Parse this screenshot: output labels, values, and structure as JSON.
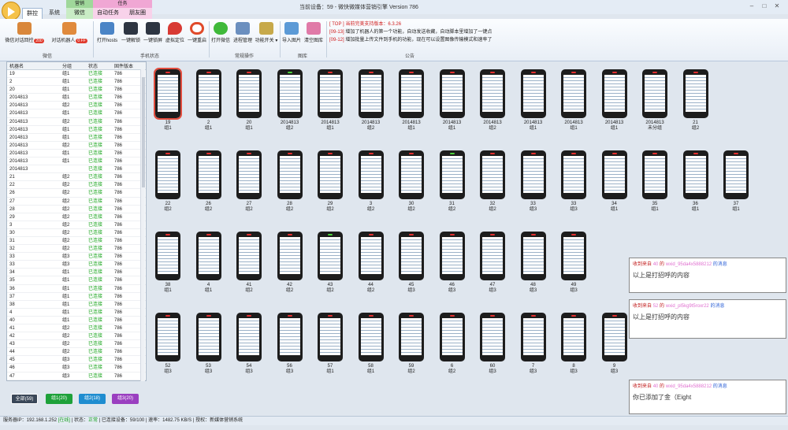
{
  "window": {
    "title": "当前设备：59 - 微快微媒体营销引擎 Version 786",
    "minimize": "–",
    "maximize": "□",
    "close": "✕"
  },
  "ribbon_tabs": {
    "ctx_green": "营销",
    "ctx_pink": "任务",
    "tabs": [
      "群控",
      "系统",
      "微信",
      "自动任务",
      "朋友圈"
    ]
  },
  "ribbon": {
    "buttons": {
      "wechat_dialog": "微信对话回控",
      "wechat_dialog_badge": "200",
      "robot_dialog": "对话机器人",
      "robot_dialog_badge": "0 FF",
      "open_hosts": "打开hosts",
      "unlock": "一键解锁",
      "lock": "一键锁屏",
      "virtual_location": "虚拟定位",
      "restart": "一键重启",
      "open_wechat": "打开微信",
      "process_mgmt": "进程管理",
      "func_switch": "功能开关",
      "import_images": "导入图片",
      "clear_gallery": "清空图库"
    },
    "groups": [
      "微信",
      "手机状态",
      "常规操作",
      "图库",
      "公告"
    ],
    "notice": {
      "line1_tag": "[ TOP ]",
      "line1": "当前完美支持版本：6.3.26",
      "line2_tag": "[09-13]",
      "line2": "增加了机器人的第一个功能，自动发送收藏，自动脚本里增加了一键点",
      "line3_tag": "[09-12]",
      "line3": "增加批量上传文件到手机的功能，现在可以设置图像传输模式和速率了"
    }
  },
  "table": {
    "headers": [
      "机器名",
      "分组",
      "状态",
      "固件版本"
    ],
    "rows": [
      [
        "19",
        "组1",
        "已连接",
        "786"
      ],
      [
        "2",
        "组1",
        "已连接",
        "786"
      ],
      [
        "20",
        "组1",
        "已连接",
        "786"
      ],
      [
        "2014813",
        "组1",
        "已连接",
        "786"
      ],
      [
        "2014813",
        "组2",
        "已连接",
        "786"
      ],
      [
        "2014813",
        "组1",
        "已连接",
        "786"
      ],
      [
        "2014813",
        "组2",
        "已连接",
        "786"
      ],
      [
        "2014813",
        "组1",
        "已连接",
        "786"
      ],
      [
        "2014813",
        "组1",
        "已连接",
        "786"
      ],
      [
        "2014813",
        "组2",
        "已连接",
        "786"
      ],
      [
        "2014813",
        "组1",
        "已连接",
        "786"
      ],
      [
        "2014813",
        "组1",
        "已连接",
        "786"
      ],
      [
        "2014813",
        "",
        "已连接",
        "786"
      ],
      [
        "21",
        "组2",
        "已连接",
        "786"
      ],
      [
        "22",
        "组2",
        "已连接",
        "786"
      ],
      [
        "26",
        "组2",
        "已连接",
        "786"
      ],
      [
        "27",
        "组2",
        "已连接",
        "786"
      ],
      [
        "28",
        "组2",
        "已连接",
        "786"
      ],
      [
        "29",
        "组2",
        "已连接",
        "786"
      ],
      [
        "3",
        "组2",
        "已连接",
        "786"
      ],
      [
        "30",
        "组2",
        "已连接",
        "786"
      ],
      [
        "31",
        "组2",
        "已连接",
        "786"
      ],
      [
        "32",
        "组2",
        "已连接",
        "786"
      ],
      [
        "33",
        "组3",
        "已连接",
        "786"
      ],
      [
        "33",
        "组3",
        "已连接",
        "786"
      ],
      [
        "34",
        "组1",
        "已连接",
        "786"
      ],
      [
        "35",
        "组1",
        "已连接",
        "786"
      ],
      [
        "36",
        "组1",
        "已连接",
        "786"
      ],
      [
        "37",
        "组1",
        "已连接",
        "786"
      ],
      [
        "38",
        "组1",
        "已连接",
        "786"
      ],
      [
        "4",
        "组1",
        "已连接",
        "786"
      ],
      [
        "40",
        "组1",
        "已连接",
        "786"
      ],
      [
        "41",
        "组2",
        "已连接",
        "786"
      ],
      [
        "42",
        "组2",
        "已连接",
        "786"
      ],
      [
        "43",
        "组2",
        "已连接",
        "786"
      ],
      [
        "44",
        "组2",
        "已连接",
        "786"
      ],
      [
        "45",
        "组3",
        "已连接",
        "786"
      ],
      [
        "46",
        "组3",
        "已连接",
        "786"
      ],
      [
        "47",
        "组3",
        "已连接",
        "786"
      ]
    ]
  },
  "filters": [
    "全部(59)",
    "组1(20)",
    "组2(18)",
    "组3(20)"
  ],
  "devices": [
    [
      "19",
      "组1",
      "r"
    ],
    [
      "2",
      "组1",
      "r"
    ],
    [
      "20",
      "组1",
      "r"
    ],
    [
      "2014813",
      "组2",
      "g"
    ],
    [
      "2014813",
      "组1",
      "r"
    ],
    [
      "2014813",
      "组2",
      "r"
    ],
    [
      "2014813",
      "组1",
      "r"
    ],
    [
      "2014813",
      "组1",
      "r"
    ],
    [
      "2014813",
      "组2",
      "r"
    ],
    [
      "2014813",
      "组1",
      "r"
    ],
    [
      "2014813",
      "组1",
      "r"
    ],
    [
      "2014813",
      "组1",
      "r"
    ],
    [
      "2014813",
      "未分组",
      "r"
    ],
    [
      "21",
      "组2",
      "r"
    ],
    [
      "22",
      "组2",
      "r"
    ],
    [
      "26",
      "组2",
      "r"
    ],
    [
      "27",
      "组2",
      "r"
    ],
    [
      "28",
      "组2",
      "r"
    ],
    [
      "29",
      "组2",
      "r"
    ],
    [
      "3",
      "组2",
      "r"
    ],
    [
      "30",
      "组2",
      "r"
    ],
    [
      "31",
      "组2",
      "g"
    ],
    [
      "32",
      "组2",
      "r"
    ],
    [
      "33",
      "组3",
      "r"
    ],
    [
      "33",
      "组3",
      "r"
    ],
    [
      "34",
      "组1",
      "r"
    ],
    [
      "35",
      "组1",
      "r"
    ],
    [
      "36",
      "组1",
      "r"
    ],
    [
      "37",
      "组1",
      "r"
    ],
    [
      "38",
      "组1",
      "r"
    ],
    [
      "4",
      "组1",
      "r"
    ],
    [
      "41",
      "组2",
      "r"
    ],
    [
      "42",
      "组2",
      "r"
    ],
    [
      "43",
      "组2",
      "g"
    ],
    [
      "44",
      "组2",
      "r"
    ],
    [
      "45",
      "组3",
      "r"
    ],
    [
      "46",
      "组3",
      "r"
    ],
    [
      "47",
      "组3",
      "r"
    ],
    [
      "48",
      "组3",
      "r"
    ],
    [
      "49",
      "组3",
      "r"
    ],
    [
      "52",
      "组3",
      "r"
    ],
    [
      "53",
      "组3",
      "r"
    ],
    [
      "54",
      "组3",
      "r"
    ],
    [
      "56",
      "组3",
      "r"
    ],
    [
      "57",
      "组1",
      "r"
    ],
    [
      "58",
      "组1",
      "r"
    ],
    [
      "59",
      "组2",
      "r"
    ],
    [
      "6",
      "组2",
      "r"
    ],
    [
      "60",
      "组3",
      "r"
    ],
    [
      "7",
      "组3",
      "r"
    ],
    [
      "8",
      "组3",
      "r"
    ],
    [
      "9",
      "组3",
      "r"
    ]
  ],
  "messages": [
    {
      "prefix": "收到来自",
      "num": "40",
      "of": "的",
      "id": "wxid_95da4x5888212",
      "suffix": "的消息",
      "body": "以上是打招呼的内容"
    },
    {
      "prefix": "收到来自",
      "num": "52",
      "of": "的",
      "id": "wxid_pl5kg9t5roxr22",
      "suffix": "的消息",
      "body": "以上是打招呼的内容"
    },
    {
      "prefix": "收到来自",
      "num": "40",
      "of": "的",
      "id": "wxid_95da4x5888212",
      "suffix": "的消息",
      "body": "你已添加了金（Eight"
    }
  ],
  "statusbar": {
    "server_label": "服务器IP：",
    "server_ip": "192.168.1.252",
    "server_state": "[在线]",
    "status_label": "| 状态：",
    "status": "正常",
    "connected_label": "| 已连接设备：",
    "connected": "59/100",
    "rate_label": "| 速率：",
    "rate": "1482.75 KB/S",
    "license": "| 授权：新媒体营销系统"
  },
  "colors": {
    "accent_red": "#e03a2d",
    "ok_green": "#16a31a",
    "filter_all": "#3a4758",
    "filter_g1": "#1ea13a",
    "filter_g2": "#1f8dd0",
    "filter_g3": "#9a3fc0"
  }
}
